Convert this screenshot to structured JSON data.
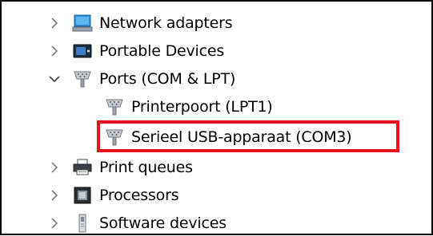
{
  "device_tree": {
    "items": [
      {
        "label": "Network adapters",
        "icon": "network-adapter-icon",
        "expander": "chevron-right"
      },
      {
        "label": "Portable Devices",
        "icon": "portable-device-icon",
        "expander": "chevron-right"
      },
      {
        "label": "Ports (COM & LPT)",
        "icon": "port-icon",
        "expander": "chevron-down"
      },
      {
        "label": "Printerpoort (LPT1)",
        "icon": "port-icon"
      },
      {
        "label": "Serieel USB-apparaat (COM3)",
        "icon": "port-icon",
        "highlighted": true
      },
      {
        "label": "Print queues",
        "icon": "printer-icon",
        "expander": "chevron-right"
      },
      {
        "label": "Processors",
        "icon": "processor-icon",
        "expander": "chevron-right"
      },
      {
        "label": "Software devices",
        "icon": "software-device-icon",
        "expander": "chevron-right"
      }
    ]
  },
  "colors": {
    "highlight": "#e8141b",
    "chevron": "#7a7a7a"
  }
}
